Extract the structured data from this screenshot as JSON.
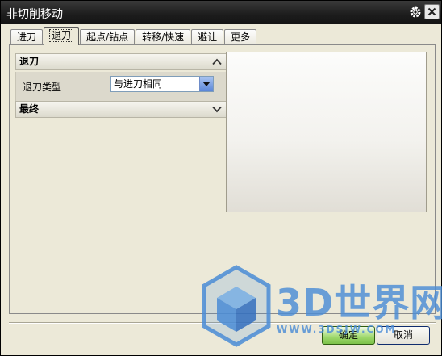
{
  "window": {
    "title": "非切削移动"
  },
  "tabs": [
    {
      "label": "进刀",
      "active": false
    },
    {
      "label": "退刀",
      "active": true
    },
    {
      "label": "起点/钻点",
      "active": false
    },
    {
      "label": "转移/快速",
      "active": false
    },
    {
      "label": "避让",
      "active": false
    },
    {
      "label": "更多",
      "active": false
    }
  ],
  "retract_group": {
    "title": "退刀",
    "type_label": "退刀类型",
    "type_value": "与进刀相同"
  },
  "final_group": {
    "title": "最终"
  },
  "buttons": {
    "ok": "确定",
    "cancel": "取消"
  },
  "watermark": {
    "text": "3D世界网",
    "url": "WWW.3DSJW.COM"
  },
  "icons": {
    "title_settings": "gear-icon",
    "title_close": "close-icon",
    "collapse": "chevron-up-icon",
    "expand": "chevron-down-icon",
    "dropdown": "dropdown-arrow-icon",
    "logo": "cube-logo-icon"
  },
  "colors": {
    "titlebar": "#1c1c1c",
    "dialog_bg": "#ece9d8",
    "dropdown_accent": "#5b86d8",
    "ok_button": "#9ed86c",
    "watermark": "#4a8cd6"
  }
}
